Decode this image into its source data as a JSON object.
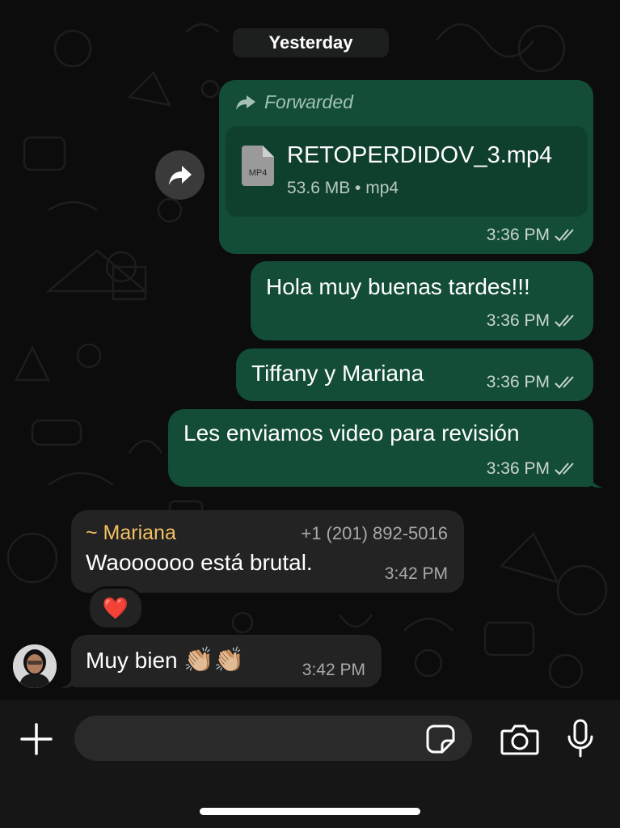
{
  "chat": {
    "date_divider": "Yesterday",
    "messages": [
      {
        "forwarded_label": "Forwarded",
        "file_name": "RETOPERDIDOV_3.mp4",
        "file_meta": "53.6 MB • mp4",
        "file_badge": "MP4",
        "time": "3:36 PM"
      },
      {
        "text": "Hola muy buenas tardes!!!",
        "time": "3:36 PM"
      },
      {
        "text": "Tiffany y Mariana",
        "time": "3:36 PM"
      },
      {
        "text": "Les enviamos video para revisión",
        "time": "3:36 PM"
      },
      {
        "sender": "~ Mariana",
        "phone": "+1 (201) 892-5016",
        "text": "Waoooooo está brutal.",
        "time": "3:42 PM",
        "reaction": "❤️"
      },
      {
        "text": "Muy bien",
        "emoji": "👏🏼👏🏼",
        "time": "3:42 PM"
      }
    ]
  },
  "colors": {
    "outgoing_bubble": "#134d37",
    "incoming_bubble": "#232323",
    "sender_name": "#f2c064"
  },
  "icons": {
    "forward": "forward-arrow-icon",
    "file": "file-icon",
    "read_receipt": "double-check-icon",
    "attach": "plus-icon",
    "sticker": "sticker-icon",
    "camera": "camera-icon",
    "mic": "microphone-icon"
  },
  "composer": {
    "placeholder": ""
  }
}
